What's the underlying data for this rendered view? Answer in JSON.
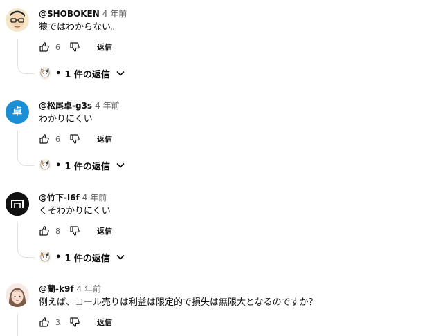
{
  "comments": [
    {
      "author": "@SHOBOKEN",
      "time": "4 年前",
      "text": "猿ではわからない。",
      "likes": "6",
      "reply_label": "返信",
      "replies_label": "1 件の返信",
      "avatar_type": "face-glasses",
      "has_replies": true
    },
    {
      "author": "@松尾卓-g3s",
      "time": "4 年前",
      "text": "わかりにくい",
      "likes": "6",
      "reply_label": "返信",
      "replies_label": "1 件の返信",
      "avatar_type": "letter",
      "avatar_letter": "卓",
      "avatar_color": "#1a8fd6",
      "has_replies": true
    },
    {
      "author": "@竹下-l6f",
      "time": "4 年前",
      "text": "くそわかりにくい",
      "likes": "8",
      "reply_label": "返信",
      "replies_label": "1 件の返信",
      "avatar_type": "black-logo",
      "has_replies": true
    },
    {
      "author": "@蘭-k9f",
      "time": "4 年前",
      "text": "例えば、コール売りは利益は限定的で損失は無限大となるのですか？",
      "likes": "3",
      "reply_label": "返信",
      "avatar_type": "face-girl",
      "has_replies": false
    }
  ],
  "icons": {
    "like": "thumb-up-icon",
    "dislike": "thumb-down-icon",
    "expand": "chevron-down-icon",
    "replier_avatar": "cat-avatar"
  },
  "colors": {
    "text": "#0f0f0f",
    "secondary": "#606060",
    "thread_line": "#e2e2e2"
  }
}
